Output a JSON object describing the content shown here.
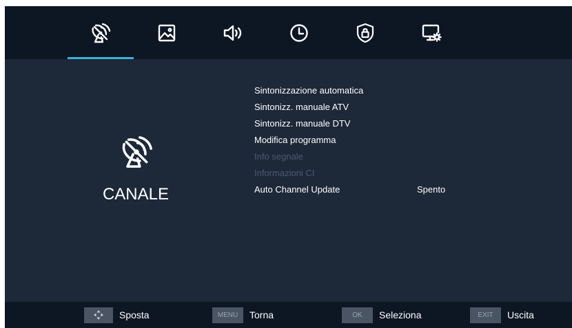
{
  "colors": {
    "background": "#1d2838",
    "bar": "#0d1623",
    "accent": "#3eb1d8",
    "text": "#ffffff",
    "disabled_text": "#4e5b6c",
    "key": "#4a5563"
  },
  "tabs": [
    {
      "icon": "satellite-dish-icon",
      "active": true
    },
    {
      "icon": "picture-icon",
      "active": false
    },
    {
      "icon": "speaker-icon",
      "active": false
    },
    {
      "icon": "clock-icon",
      "active": false
    },
    {
      "icon": "lock-shield-icon",
      "active": false
    },
    {
      "icon": "monitor-settings-icon",
      "active": false
    }
  ],
  "section": {
    "icon": "satellite-dish-icon",
    "title": "CANALE"
  },
  "menu": {
    "items": [
      {
        "label": "Sintonizzazione automatica",
        "enabled": true
      },
      {
        "label": "Sintonizz. manuale ATV",
        "enabled": true
      },
      {
        "label": "Sintonizz. manuale DTV",
        "enabled": true
      },
      {
        "label": "Modifica programma",
        "enabled": true
      },
      {
        "label": "Info segnale",
        "enabled": false
      },
      {
        "label": "Informazioni CI",
        "enabled": false
      },
      {
        "label": "Auto Channel Update",
        "enabled": true,
        "value": "Spento"
      }
    ]
  },
  "hints": [
    {
      "key_icon": "arrows-icon",
      "key": "",
      "label": "Sposta"
    },
    {
      "key": "MENU",
      "label": "Torna"
    },
    {
      "key": "OK",
      "label": "Seleziona"
    },
    {
      "key": "EXIT",
      "label": "Uscita"
    }
  ]
}
